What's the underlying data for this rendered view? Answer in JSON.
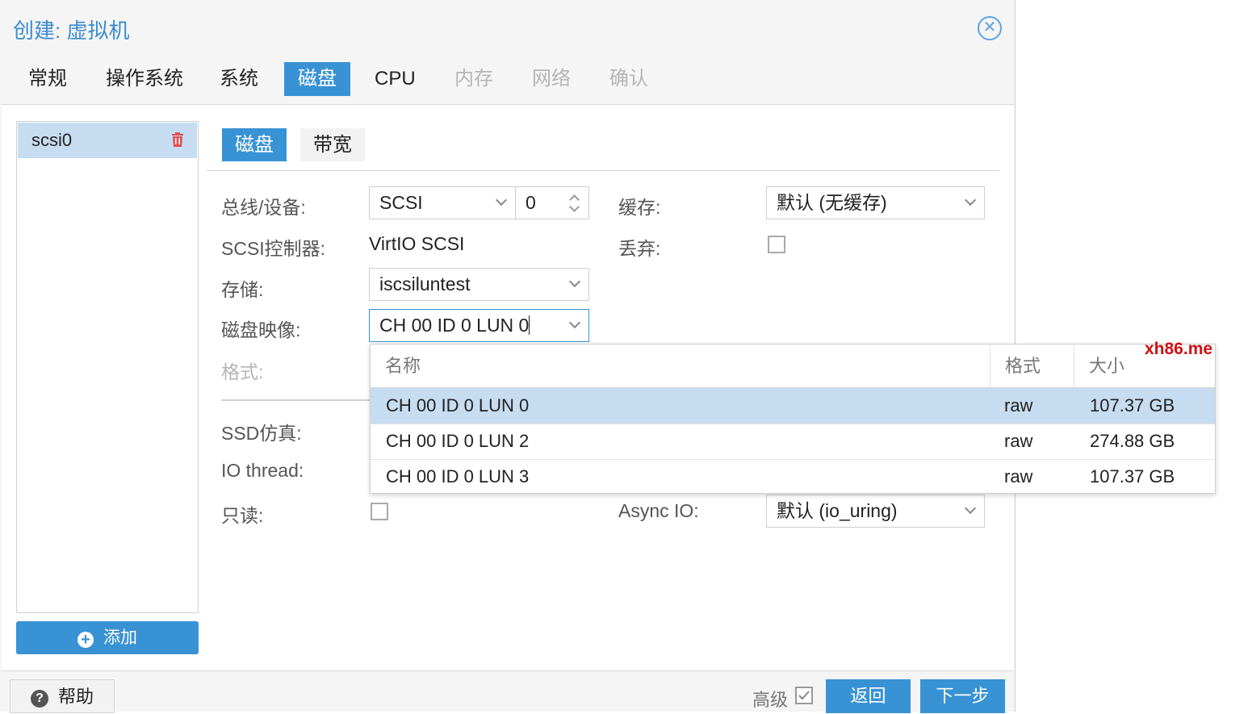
{
  "window": {
    "title": "创建: 虚拟机",
    "close_icon": "close-circle-icon"
  },
  "tabs": [
    {
      "label": "常规",
      "state": "normal"
    },
    {
      "label": "操作系统",
      "state": "normal"
    },
    {
      "label": "系统",
      "state": "normal"
    },
    {
      "label": "磁盘",
      "state": "active"
    },
    {
      "label": "CPU",
      "state": "normal"
    },
    {
      "label": "内存",
      "state": "disabled"
    },
    {
      "label": "网络",
      "state": "disabled"
    },
    {
      "label": "确认",
      "state": "disabled"
    }
  ],
  "disk_list": {
    "items": [
      {
        "label": "scsi0",
        "icon": "trash-icon"
      }
    ],
    "add_label": "添加"
  },
  "subtabs": [
    {
      "label": "磁盘",
      "state": "active"
    },
    {
      "label": "带宽",
      "state": "normal"
    }
  ],
  "form": {
    "bus_device_label": "总线/设备:",
    "bus_value": "SCSI",
    "device_value": "0",
    "scsi_controller_label": "SCSI控制器:",
    "scsi_controller_value": "VirtIO SCSI",
    "storage_label": "存储:",
    "storage_value": "iscsiluntest",
    "disk_image_label": "磁盘映像:",
    "disk_image_value": "CH 00 ID 0 LUN 0",
    "format_label": "格式:",
    "ssd_label": "SSD仿真:",
    "io_thread_label": "IO thread:",
    "readonly_label": "只读:",
    "cache_label": "缓存:",
    "cache_value": "默认 (无缓存)",
    "discard_label": "丢弃:",
    "async_io_label": "Async IO:",
    "async_io_value": "默认 (io_uring)"
  },
  "dropdown": {
    "headers": [
      "名称",
      "格式",
      "大小"
    ],
    "rows": [
      {
        "name": "CH 00 ID 0 LUN 0",
        "format": "raw",
        "size": "107.37 GB",
        "selected": true
      },
      {
        "name": "CH 00 ID 0 LUN 2",
        "format": "raw",
        "size": "274.88 GB",
        "selected": false
      },
      {
        "name": "CH 00 ID 0 LUN 3",
        "format": "raw",
        "size": "107.37 GB",
        "selected": false
      }
    ]
  },
  "watermark": "xh86.me",
  "footer": {
    "help_label": "帮助",
    "advanced_label": "高级",
    "advanced_checked": true,
    "back_label": "返回",
    "next_label": "下一步"
  },
  "colors": {
    "accent": "#3892d4",
    "selected_row": "#c6dcf0",
    "title": "#3a8ccf",
    "trash": "#e05050",
    "watermark": "#d01010"
  }
}
